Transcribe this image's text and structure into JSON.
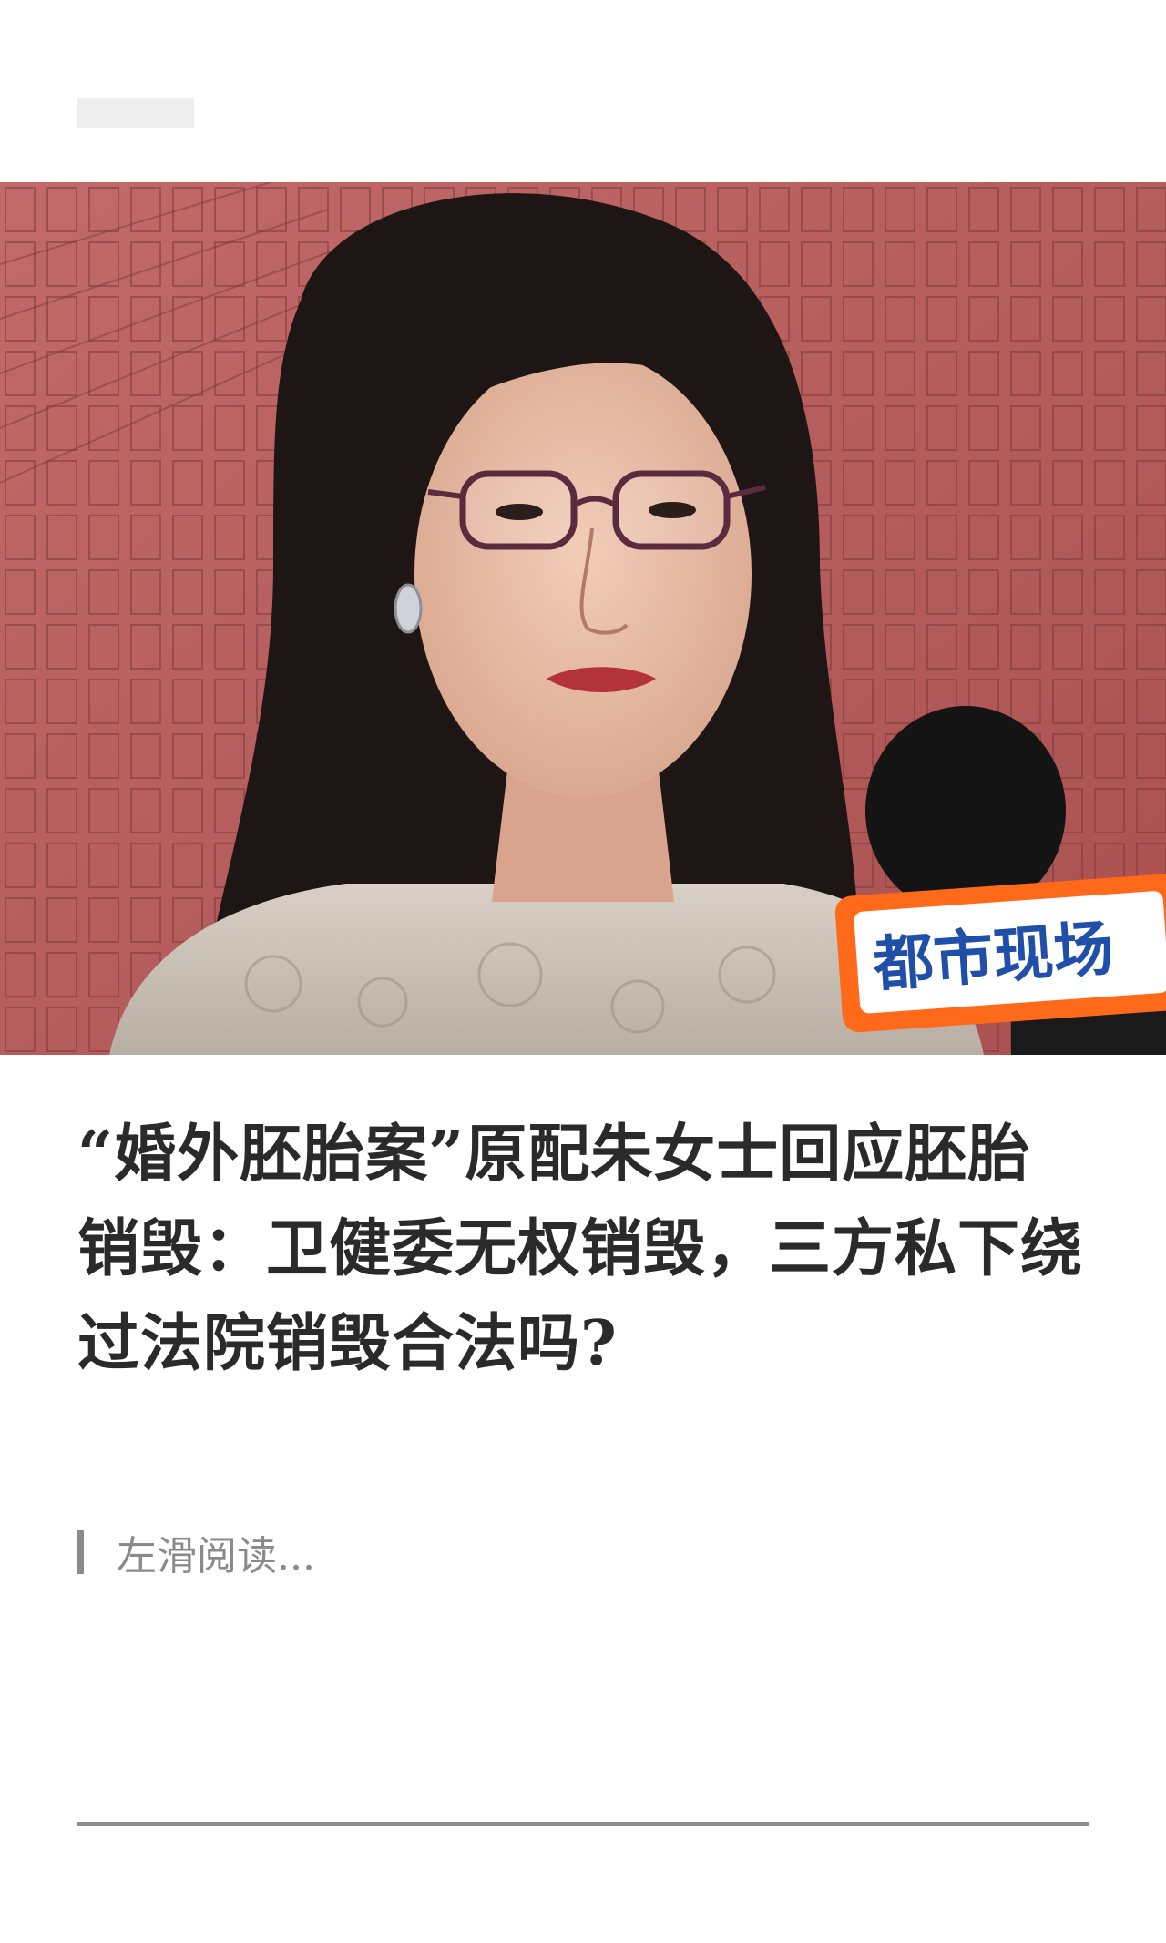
{
  "article": {
    "title": "“婚外胚胎案”原配朱女士回应胚胎销毁：卫健委无权销毁，三方私下绕过法院销毁合法吗?",
    "swipe_hint": "左滑阅读..."
  },
  "hero_image": {
    "mic_flag_text": "都市现场",
    "colors": {
      "background_wall": "#b85f60",
      "mic_flag": "#ff6a1a"
    }
  }
}
